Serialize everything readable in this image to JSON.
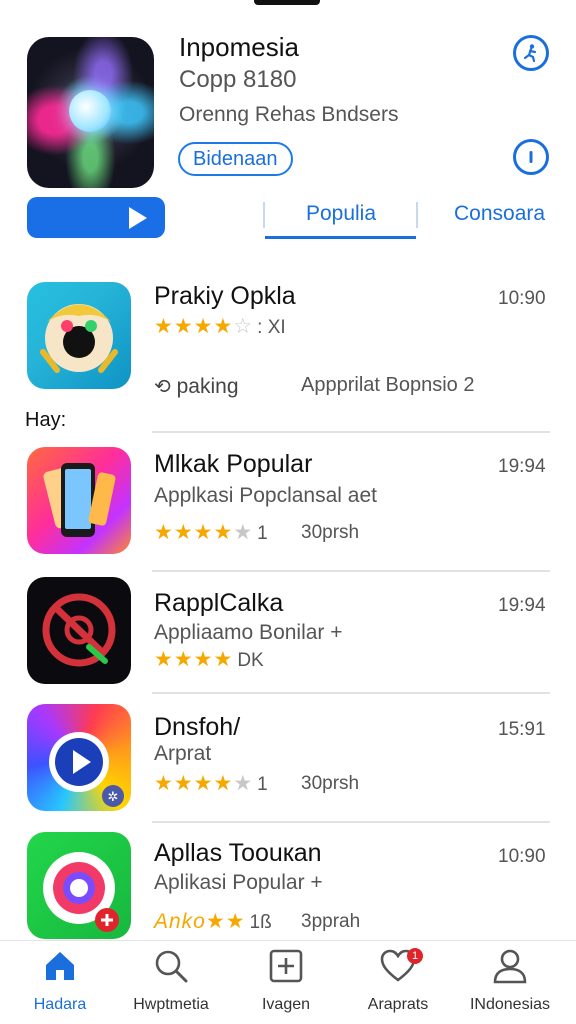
{
  "header": {
    "title": "Inpomesia",
    "subtitle": "Copp 8180",
    "developer": "Orenng Rehas Bndsers",
    "badge": "Bidenaan",
    "tabs": [
      {
        "label": "Populia",
        "active": true
      },
      {
        "label": "Consoara",
        "active": false
      }
    ]
  },
  "featured": {
    "title": "Prakiy Opkla",
    "time": "10:90",
    "rating": 4,
    "rating_suffix": ": XI",
    "meta_left": "paking",
    "meta_right": "Appprilat Bopnsio 2"
  },
  "section_label": "Hay:",
  "apps": [
    {
      "title": "Mlkak Popular",
      "subtitle": "Applkasi Popclansal  aet",
      "time": "19:94",
      "rating": 4,
      "rating_suffix": "1",
      "downloads": "30prsh"
    },
    {
      "title": "RapplCalka",
      "subtitle": "Appliaamo Bonilar +",
      "time": "19:94",
      "rating": 4,
      "rating_suffix": "DK",
      "downloads": ""
    },
    {
      "title": "Dnsfoh/",
      "subtitle": "Arprat",
      "time": "15:91",
      "rating": 4,
      "rating_suffix": "1",
      "downloads": "30prsh"
    },
    {
      "title": "Apllas Toouкan",
      "subtitle": "Aplikasi Popular +",
      "time": "10:90",
      "rating": 4,
      "rating_suffix": "1ß",
      "downloads": "3pprah",
      "stars_text": "Anko"
    }
  ],
  "nav": [
    {
      "label": "Hadara",
      "icon": "home-icon",
      "active": true
    },
    {
      "label": "Hwptmetia",
      "icon": "search-icon",
      "active": false
    },
    {
      "label": "Ivagen",
      "icon": "plus-square-icon",
      "active": false
    },
    {
      "label": "Araprats",
      "icon": "heart-icon",
      "active": false,
      "badge": "1"
    },
    {
      "label": "INdonesias",
      "icon": "person-icon",
      "active": false
    }
  ],
  "colors": {
    "accent": "#1a6fdc",
    "star": "#f5a800",
    "badge": "#e0242c"
  }
}
